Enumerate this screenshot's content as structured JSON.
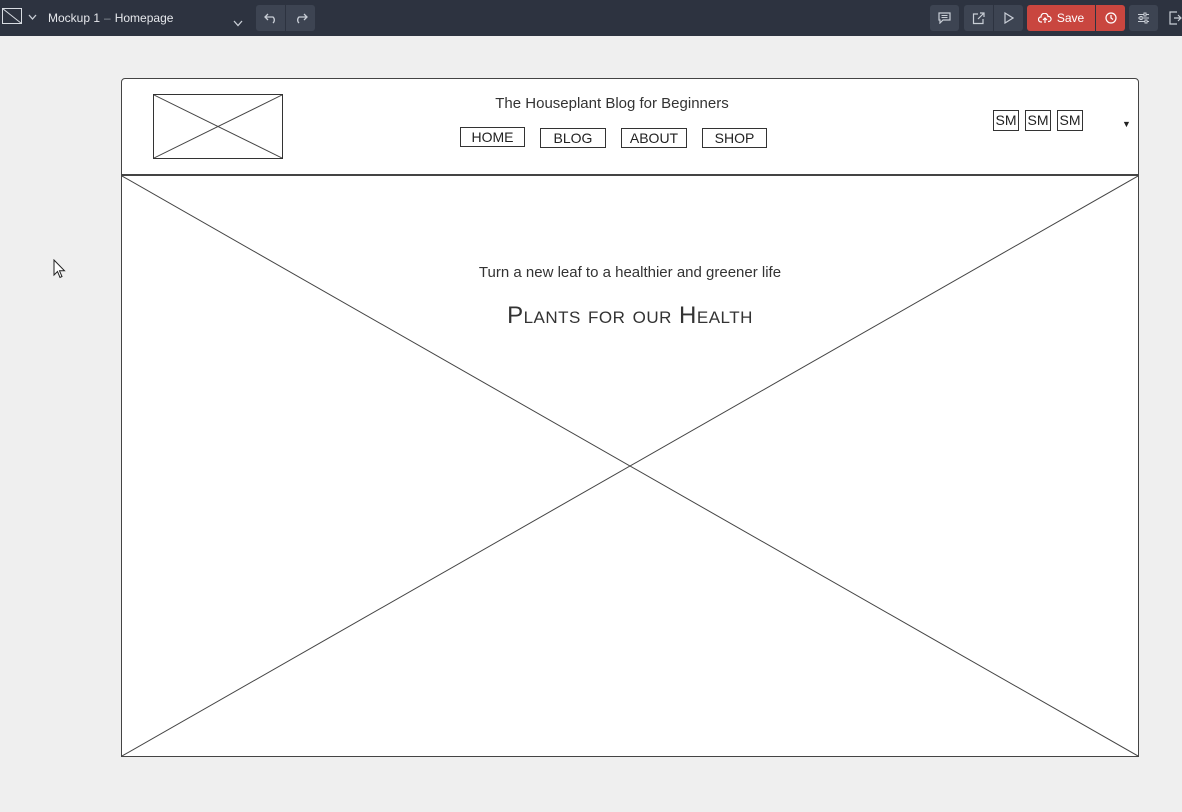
{
  "toolbar": {
    "project_name": "Mockup 1",
    "separator": "–",
    "page_name": "Homepage",
    "save_label": "Save",
    "save_color": "#c9463f",
    "background_color": "#2d3340",
    "icons": [
      "app-logo-icon",
      "undo-icon",
      "redo-icon",
      "comment-icon",
      "external-link-icon",
      "play-icon",
      "upload-cloud-icon",
      "history-icon",
      "settings-sliders-icon",
      "exit-icon"
    ]
  },
  "mockup": {
    "header": {
      "site_title": "The Houseplant Blog for Beginners",
      "nav": [
        "HOME",
        "BLOG",
        "ABOUT",
        "SHOP"
      ],
      "social": [
        "SM",
        "SM",
        "SM"
      ],
      "dropdown_arrow": "▼"
    },
    "hero": {
      "tagline": "Turn a new leaf to a healthier and greener life",
      "title": "Plants for our Health"
    }
  }
}
